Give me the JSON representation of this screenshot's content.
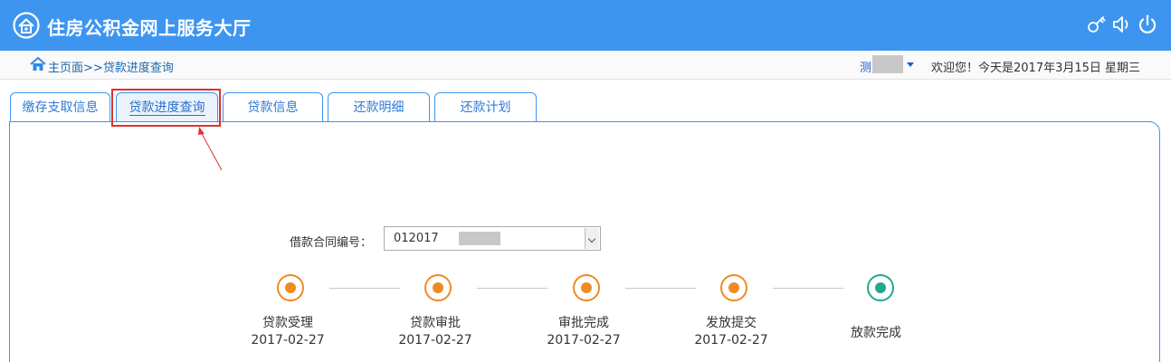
{
  "app": {
    "title": "住房公积金网上服务大厅"
  },
  "header_icons": [
    "key-icon",
    "speaker-icon",
    "power-icon"
  ],
  "breadcrumb": {
    "home": "主页面",
    "separator": ">>",
    "current": "贷款进度查询"
  },
  "user": {
    "name": "测",
    "welcome": "欢迎您！今天是2017年3月15日 星期三"
  },
  "tabs": [
    {
      "label": "缴存支取信息",
      "active": false
    },
    {
      "label": "贷款进度查询",
      "active": true
    },
    {
      "label": "贷款信息",
      "active": false
    },
    {
      "label": "还款明细",
      "active": false
    },
    {
      "label": "还款计划",
      "active": false
    }
  ],
  "contract": {
    "label": "借款合同编号：",
    "value": "012017"
  },
  "steps": [
    {
      "name": "贷款受理",
      "date": "2017-02-27",
      "status": "pending"
    },
    {
      "name": "贷款审批",
      "date": "2017-02-27",
      "status": "pending"
    },
    {
      "name": "审批完成",
      "date": "2017-02-27",
      "status": "pending"
    },
    {
      "name": "发放提交",
      "date": "2017-02-27",
      "status": "pending"
    },
    {
      "name": "放款完成",
      "date": "",
      "status": "done"
    }
  ],
  "colors": {
    "header": "#3d95f0",
    "step_pending": "#f08a24",
    "step_done": "#22a890",
    "highlight": "#e03030"
  }
}
